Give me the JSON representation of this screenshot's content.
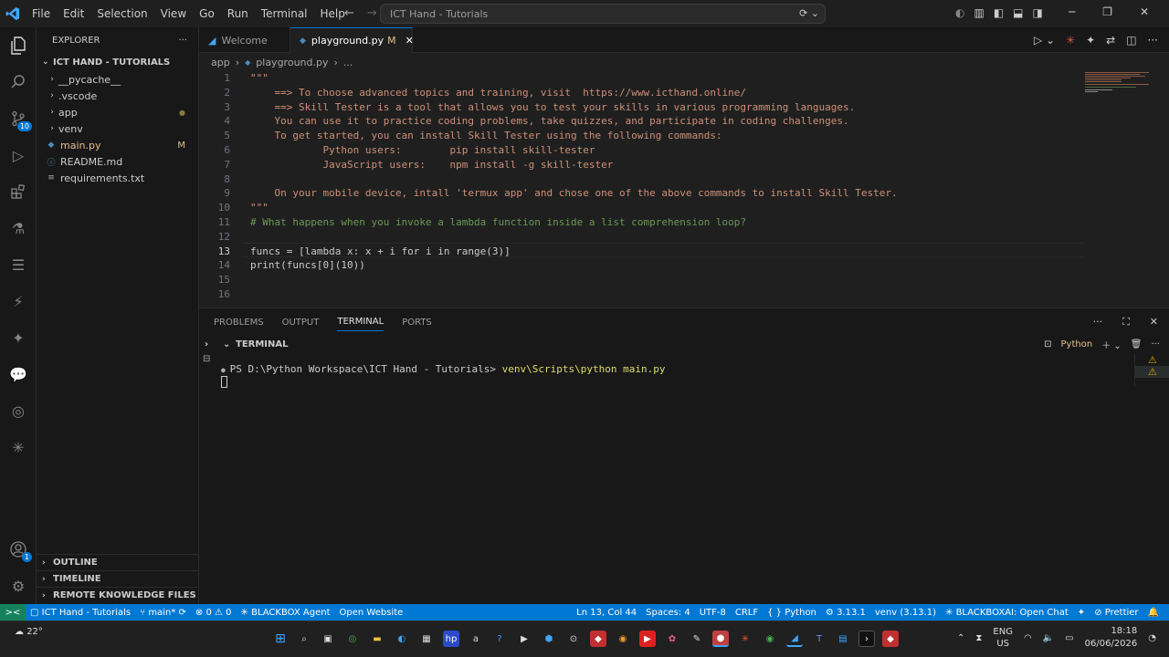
{
  "menu": [
    "File",
    "Edit",
    "Selection",
    "View",
    "Go",
    "Run",
    "Terminal",
    "Help"
  ],
  "search_text": "ICT Hand - Tutorials",
  "explorer": {
    "title": "EXPLORER",
    "project": "ICT HAND - TUTORIALS",
    "items": [
      {
        "label": "__pycache__",
        "type": "folder",
        "status": ""
      },
      {
        "label": ".vscode",
        "type": "folder",
        "status": ""
      },
      {
        "label": "app",
        "type": "folder",
        "status": "●"
      },
      {
        "label": "venv",
        "type": "folder",
        "status": ""
      },
      {
        "label": "main.py",
        "type": "python",
        "status": "M"
      },
      {
        "label": "README.md",
        "type": "markdown",
        "status": ""
      },
      {
        "label": "requirements.txt",
        "type": "text",
        "status": ""
      }
    ],
    "sections": [
      "OUTLINE",
      "TIMELINE",
      "REMOTE KNOWLEDGE FILES"
    ]
  },
  "tabs": [
    {
      "label": "Welcome",
      "modified": ""
    },
    {
      "label": "playground.py",
      "modified": "M"
    }
  ],
  "breadcrumb": [
    "app",
    "playground.py",
    "..."
  ],
  "code_lines": [
    {
      "n": "1",
      "text": "\"\"\"",
      "kind": "string"
    },
    {
      "n": "2",
      "text": "    ==> To choose advanced topics and training, visit  https://www.icthand.online/",
      "kind": "string"
    },
    {
      "n": "3",
      "text": "    ==> Skill Tester is a tool that allows you to test your skills in various programming languages.",
      "kind": "string"
    },
    {
      "n": "4",
      "text": "    You can use it to practice coding problems, take quizzes, and participate in coding challenges.",
      "kind": "string"
    },
    {
      "n": "5",
      "text": "    To get started, you can install Skill Tester using the following commands:",
      "kind": "string"
    },
    {
      "n": "6",
      "text": "            Python users:        pip install skill-tester",
      "kind": "string"
    },
    {
      "n": "7",
      "text": "            JavaScript users:    npm install -g skill-tester",
      "kind": "string"
    },
    {
      "n": "8",
      "text": "",
      "kind": "string"
    },
    {
      "n": "9",
      "text": "    On your mobile device, intall 'termux app' and chose one of the above commands to install Skill Tester.",
      "kind": "string"
    },
    {
      "n": "10",
      "text": "\"\"\"",
      "kind": "string"
    },
    {
      "n": "11",
      "text": "# What happens when you invoke a lambda function inside a list comprehension loop?",
      "kind": "comment"
    },
    {
      "n": "12",
      "text": "",
      "kind": "plain"
    },
    {
      "n": "13",
      "text": "funcs = [lambda x: x + i for i in range(3)]",
      "kind": "plain"
    },
    {
      "n": "14",
      "text": "print(funcs[0](10))",
      "kind": "plain"
    },
    {
      "n": "15",
      "text": "",
      "kind": "plain"
    },
    {
      "n": "16",
      "text": "",
      "kind": "plain"
    }
  ],
  "panel": {
    "tabs": [
      "PROBLEMS",
      "OUTPUT",
      "TERMINAL",
      "PORTS"
    ],
    "active_tab": "TERMINAL",
    "terminal_title": "TERMINAL",
    "shell_label": "Python",
    "prompt": "PS D:\\Python Workspace\\ICT Hand - Tutorials> ",
    "command": "venv\\Scripts\\python main.py"
  },
  "status": {
    "remote": "><",
    "workspace": "ICT Hand - Tutorials",
    "branch": "main*",
    "errors": "0",
    "warnings": "0",
    "blackbox": "BLACKBOX Agent",
    "open_website": "Open Website",
    "position": "Ln 13, Col 44",
    "spaces": "Spaces: 4",
    "encoding": "UTF-8",
    "eol": "CRLF",
    "language": "Python",
    "py_version": "3.13.1",
    "venv": "venv (3.13.1)",
    "blackbox_chat": "BLACKBOXAI: Open Chat",
    "prettier": "Prettier"
  },
  "taskbar": {
    "weather": "22°",
    "lang": "ENG",
    "region": "US",
    "time": "18:18",
    "date": "06/06/2026"
  },
  "colors": {
    "accent": "#0078d4",
    "string": "#ce9178",
    "comment": "#6a9955"
  }
}
